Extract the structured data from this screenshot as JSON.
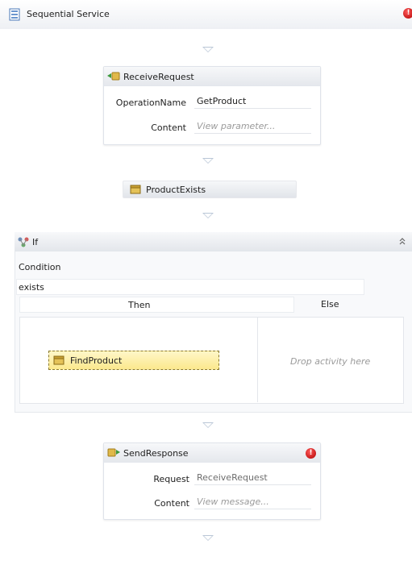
{
  "workflow": {
    "title": "Sequential Service",
    "colors": {
      "error": "#c00000",
      "selection": "#fbe88d",
      "arrow": "#b9c6d6"
    }
  },
  "receive_request": {
    "title": "ReceiveRequest",
    "operation_name_label": "OperationName",
    "operation_name_value": "GetProduct",
    "content_label": "Content",
    "content_value": "View parameter..."
  },
  "product_exists": {
    "title": "ProductExists"
  },
  "if_activity": {
    "title": "If",
    "condition_label": "Condition",
    "condition_value": "exists",
    "then_label": "Then",
    "else_label": "Else",
    "then_activity": "FindProduct",
    "else_placeholder": "Drop activity here"
  },
  "send_response": {
    "title": "SendResponse",
    "request_label": "Request",
    "request_value": "ReceiveRequest",
    "content_label": "Content",
    "content_value": "View message..."
  },
  "error_glyph": "!"
}
